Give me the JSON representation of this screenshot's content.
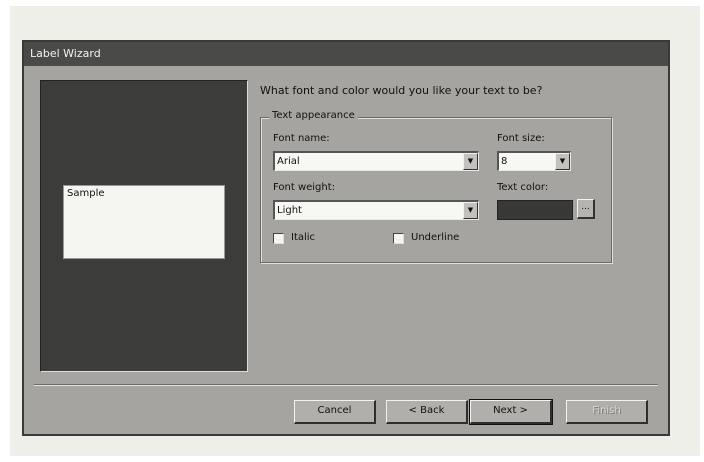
{
  "window": {
    "title": "Label Wizard"
  },
  "preview": {
    "sample_text": "Sample"
  },
  "question": "What font and color would you like your text to be?",
  "group": {
    "title": "Text appearance",
    "font_name": {
      "label": "Font name:",
      "value": "Arial"
    },
    "font_size": {
      "label": "Font size:",
      "value": "8"
    },
    "font_weight": {
      "label": "Font weight:",
      "value": "Light"
    },
    "text_color": {
      "label": "Text color:",
      "color": "#383836",
      "button_label": "..."
    },
    "italic": {
      "label": "Italic",
      "checked": false
    },
    "underline": {
      "label": "Underline",
      "checked": false
    }
  },
  "buttons": {
    "cancel": "Cancel",
    "back": "< Back",
    "next": "Next >",
    "finish": "Finish"
  }
}
